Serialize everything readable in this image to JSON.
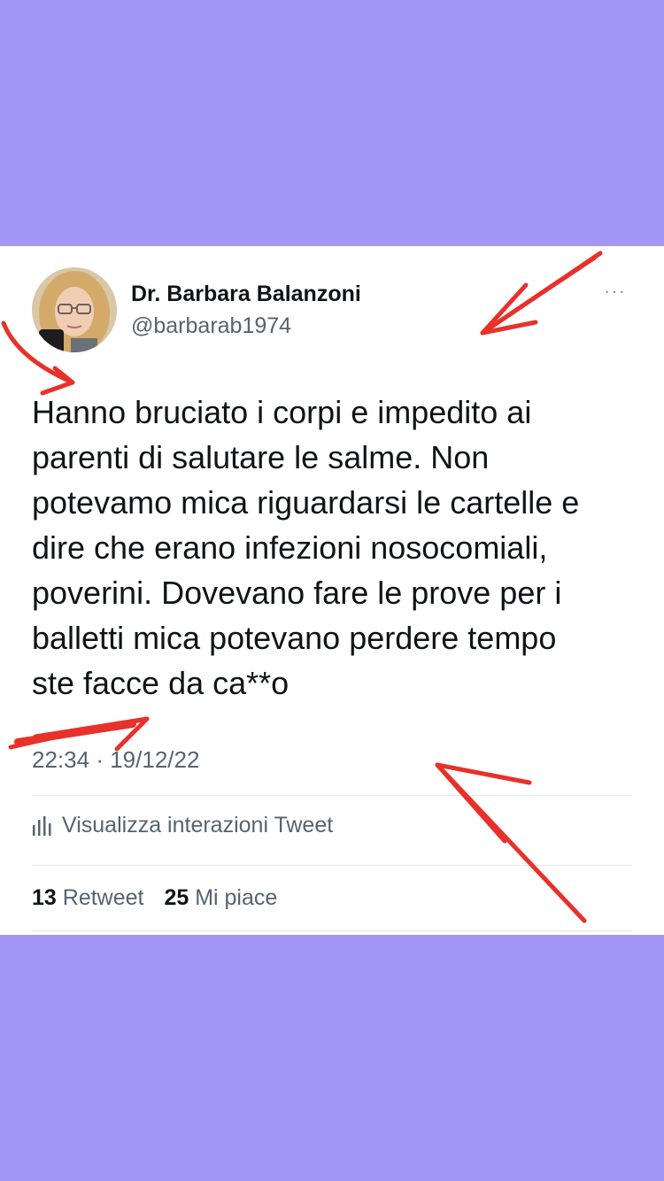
{
  "tweet": {
    "author_name": "Dr. Barbara Balanzoni",
    "author_handle": "@barbarab1974",
    "more_icon": "···",
    "text_lines": [
      "Hanno bruciato i corpi e impedito ai",
      "parenti di salutare le salme. Non",
      "potevamo mica riguardarsi  le cartelle e",
      "dire che erano infezioni nosocomiali,",
      "poverini. Dovevano fare le prove per i",
      "balletti mica potevano perdere tempo",
      "ste facce da ca**o"
    ],
    "time": "22:34",
    "date": "19/12/22",
    "time_separator": "·",
    "analytics_label": "Visualizza interazioni Tweet",
    "retweets_count": "13",
    "retweets_label": "Retweet",
    "likes_count": "25",
    "likes_label": "Mi piace"
  },
  "icons": {
    "more": "more-options-icon",
    "analytics": "analytics-bars-icon"
  },
  "colors": {
    "background": "#a395f6",
    "card": "#ffffff",
    "annotation": "#e8312a",
    "secondary_text": "#536471"
  }
}
